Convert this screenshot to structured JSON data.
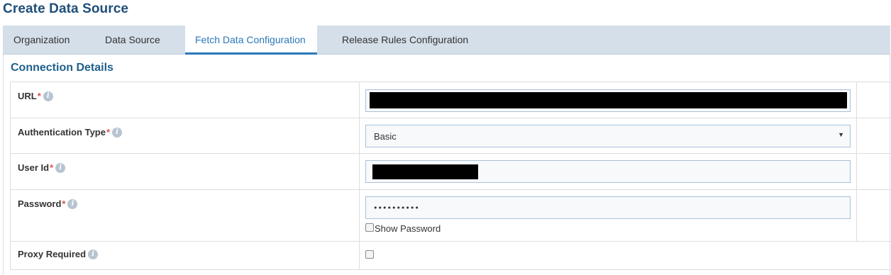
{
  "page": {
    "title": "Create Data Source"
  },
  "tabs": [
    {
      "label": "Organization",
      "active": false
    },
    {
      "label": "Data Source",
      "active": false
    },
    {
      "label": "Fetch Data Configuration",
      "active": true
    },
    {
      "label": "Release Rules Configuration",
      "active": false
    }
  ],
  "section": {
    "title": "Connection Details"
  },
  "form": {
    "url": {
      "label": "URL",
      "required_marker": "*",
      "value": ""
    },
    "auth_type": {
      "label": "Authentication Type",
      "required_marker": "*",
      "selected": "Basic"
    },
    "user_id": {
      "label": "User Id",
      "required_marker": "*",
      "value": ""
    },
    "password": {
      "label": "Password",
      "required_marker": "*",
      "masked_value": "••••••••••",
      "show_password_label": "Show Password",
      "show_password_checked": false
    },
    "proxy": {
      "label": "Proxy Required",
      "checked": false
    }
  },
  "icons": {
    "info": "info-icon",
    "dropdown": "caret-down-icon"
  },
  "colors": {
    "title": "#1f4e79",
    "tab_bar": "#d5dfea",
    "active_tab": "#2b78b8",
    "required": "#d9534f",
    "info_icon": "#b7c4d1"
  }
}
